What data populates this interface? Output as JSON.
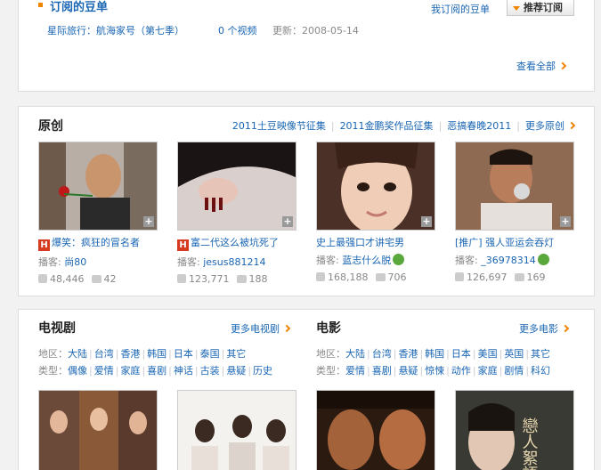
{
  "subscriptions": {
    "title": "订阅的豆单",
    "my_subscriptions": "我订阅的豆单",
    "recommend_button": "推荐订阅",
    "item": {
      "name": "星际旅行：航海家号（第七季）",
      "count": "0 个视频",
      "updated": "更新：2008-05-14"
    },
    "view_all": "查看全部"
  },
  "original": {
    "heading": "原创",
    "links": [
      "2011土豆映像节征集",
      "2011金鹏奖作品征集",
      "恶搞春晚2011",
      "更多原创"
    ],
    "videos": [
      {
        "badge": "H",
        "title": "爆笑：疯狂的冒名者",
        "author_label": "播客:",
        "author": "尚80",
        "star": false,
        "plays": "48,446",
        "comments": "42"
      },
      {
        "badge": "H",
        "title": "富二代这么被坑死了",
        "author_label": "播客:",
        "author": "jesus881214",
        "star": false,
        "plays": "123,771",
        "comments": "188"
      },
      {
        "badge": "",
        "title": "史上最强口才讲宅男",
        "author_label": "播客:",
        "author": "蓝志什么脱",
        "star": true,
        "plays": "168,188",
        "comments": "706"
      },
      {
        "badge": "",
        "title": "[推广] 强人亚运会吞灯",
        "author_label": "播客:",
        "author": "_36978314",
        "star": true,
        "plays": "126,697",
        "comments": "169"
      }
    ]
  },
  "tv": {
    "heading": "电视剧",
    "more": "更多电视剧",
    "region_label": "地区：",
    "regions": [
      "大陆",
      "台湾",
      "香港",
      "韩国",
      "日本",
      "泰国",
      "其它"
    ],
    "type_label": "类型：",
    "types": [
      "偶像",
      "爱情",
      "家庭",
      "喜剧",
      "神话",
      "古装",
      "悬疑",
      "历史"
    ]
  },
  "movies": {
    "heading": "电影",
    "more": "更多电影",
    "region_label": "地区：",
    "regions": [
      "大陆",
      "台湾",
      "香港",
      "韩国",
      "日本",
      "美国",
      "英国",
      "其它"
    ],
    "type_label": "类型：",
    "types": [
      "爱情",
      "喜剧",
      "悬疑",
      "惊悚",
      "动作",
      "家庭",
      "剧情",
      "科幻"
    ],
    "poster_text": "戀人絮語"
  },
  "colors": {
    "accent": "#f08300",
    "link": "#1a66b3",
    "badge": "#d63a1f",
    "star": "#5aa83c"
  }
}
